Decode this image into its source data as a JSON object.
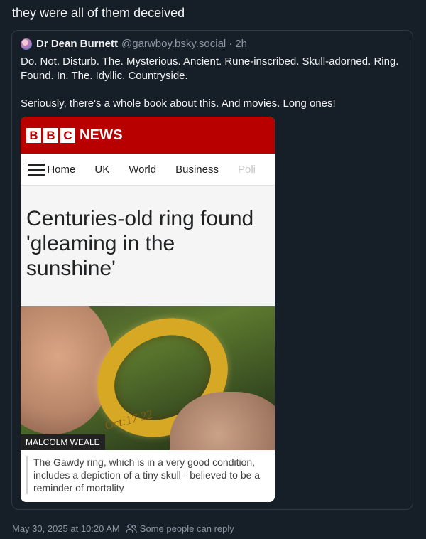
{
  "post": {
    "text": "they were all of them deceived"
  },
  "quote": {
    "author_name": "Dr Dean Burnett",
    "handle": "@garwboy.bsky.social",
    "separator": "·",
    "time": "2h",
    "paragraph1": "Do. Not. Disturb. The. Mysterious. Ancient. Rune-inscribed. Skull-adorned. Ring. Found. In. The. Idyllic. Countryside.",
    "paragraph2": "Seriously, there's a whole book about this. And movies. Long ones!"
  },
  "embed": {
    "logo_letters": [
      "B",
      "B",
      "C"
    ],
    "logo_word": "NEWS",
    "nav": [
      "Home",
      "UK",
      "World",
      "Business",
      "Poli"
    ],
    "headline": "Centuries-old ring found 'gleaming in the sunshine'",
    "inscription": "Oct:17 22",
    "credit": "MALCOLM WEALE",
    "caption": "The Gawdy ring, which is in a very good condition, includes a depiction of a tiny skull - believed to be a reminder of mortality",
    "colors": {
      "brand_red": "#b80000"
    }
  },
  "footer": {
    "date": "May 30, 2025 at 10:20 AM",
    "reply_setting": "Some people can reply",
    "icon": "people-icon"
  }
}
